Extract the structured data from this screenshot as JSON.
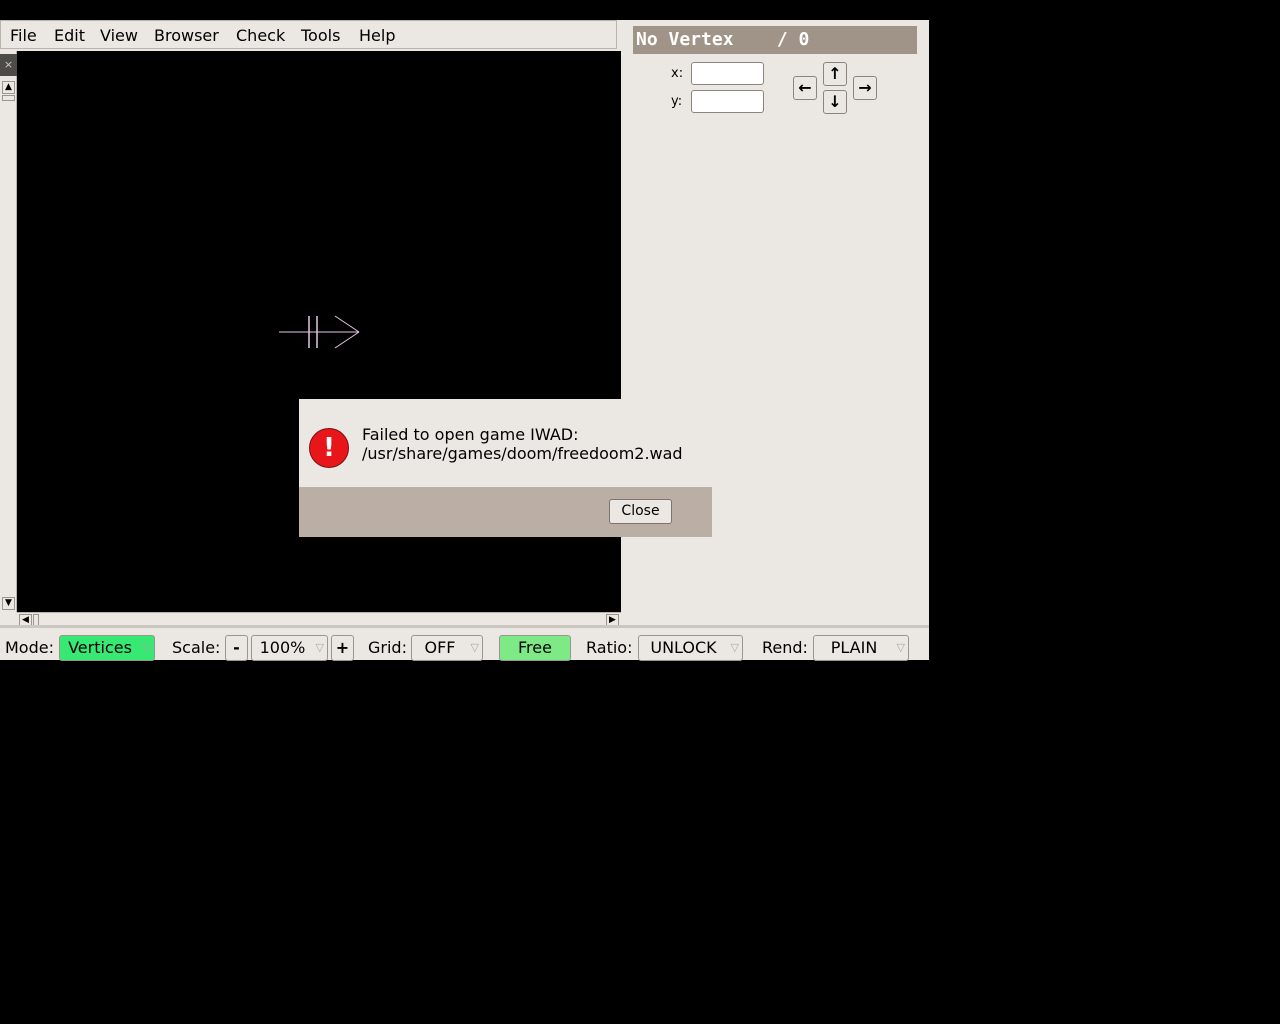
{
  "menu": {
    "file": "File",
    "edit": "Edit",
    "view": "View",
    "browser": "Browser",
    "check": "Check",
    "tools": "Tools",
    "help": "Help"
  },
  "panel": {
    "title": "No Vertex    / 0",
    "x_label": "x:",
    "y_label": "y:",
    "x_value": "",
    "y_value": ""
  },
  "status": {
    "mode_label": "Mode:",
    "mode_value": "Vertices",
    "scale_label": "Scale:",
    "scale_minus": "-",
    "scale_value": "100%",
    "scale_plus": "+",
    "grid_label": "Grid:",
    "grid_value": "OFF",
    "free": "Free",
    "ratio_label": "Ratio:",
    "ratio_value": "UNLOCK",
    "rend_label": "Rend:",
    "rend_value": "PLAIN"
  },
  "dialog": {
    "line1": "Failed to open game IWAD:",
    "line2": "/usr/share/games/doom/freedoom2.wad",
    "close": "Close",
    "icon": "error-icon"
  },
  "colors": {
    "mode_active": "#37e873",
    "free_active": "#7dea86",
    "dialog_footer": "#bbafa5",
    "vertex_header": "#a09488"
  }
}
